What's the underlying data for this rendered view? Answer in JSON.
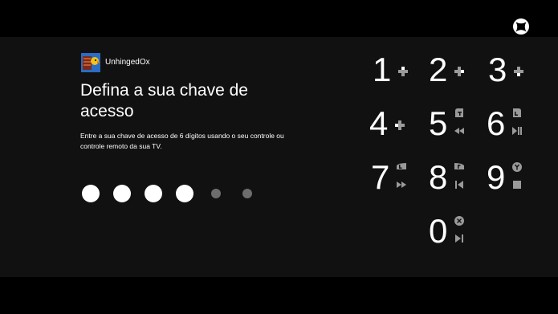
{
  "profile": {
    "gamertag": "UnhingedOx"
  },
  "page": {
    "title": "Defina a sua chave de acesso",
    "instructions": "Entre a sua chave de acesso de 6 dígitos usando o seu controle ou controle remoto da sua TV."
  },
  "passcode": {
    "length": 6,
    "entered": 4
  },
  "keypad": [
    {
      "digit": "1",
      "icons": [
        "dpad-up-icon"
      ]
    },
    {
      "digit": "2",
      "icons": [
        "dpad-right-icon"
      ]
    },
    {
      "digit": "3",
      "icons": [
        "dpad-down-icon"
      ]
    },
    {
      "digit": "4",
      "icons": [
        "dpad-left-icon"
      ]
    },
    {
      "digit": "5",
      "icons": [
        "rt-trigger-icon",
        "rewind-icon"
      ]
    },
    {
      "digit": "6",
      "icons": [
        "lt-trigger-icon",
        "play-pause-icon"
      ]
    },
    {
      "digit": "7",
      "icons": [
        "lb-bumper-icon",
        "fast-forward-icon"
      ]
    },
    {
      "digit": "8",
      "icons": [
        "rb-bumper-icon",
        "previous-track-icon"
      ]
    },
    {
      "digit": "9",
      "icons": [
        "y-button-icon",
        "stop-icon"
      ]
    },
    {
      "digit": "0",
      "icons": [
        "x-button-icon",
        "next-track-icon"
      ]
    }
  ],
  "colors": {
    "background": "#000000",
    "panel": "#111111",
    "empty_dot": "#6d6d6d",
    "glyph": "#9a9a9a"
  }
}
